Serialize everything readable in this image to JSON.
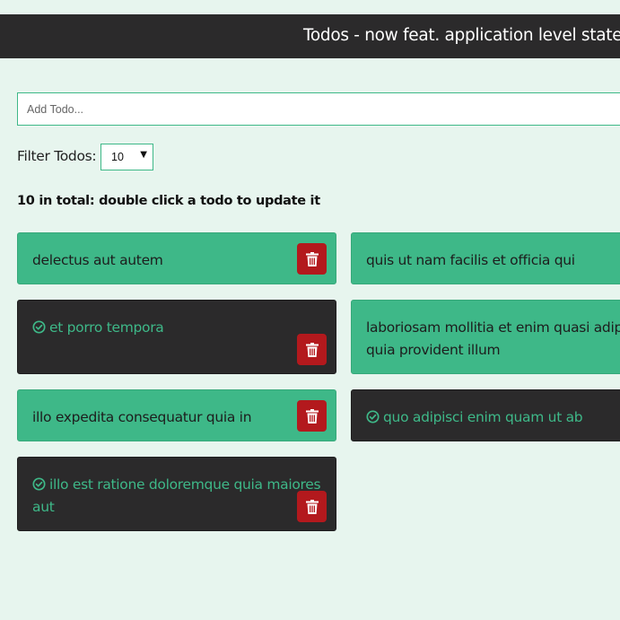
{
  "header": {
    "title": "Todos - now feat. application level state m"
  },
  "add_todo": {
    "placeholder": "Add Todo..."
  },
  "filter": {
    "label": "Filter Todos:",
    "selected": "10"
  },
  "summary": "10 in total: double click a todo to update it",
  "colors": {
    "accent": "#3eb888",
    "dark": "#2b2a2b",
    "danger": "#b3191d",
    "background": "#e7f5ee"
  },
  "todos": [
    {
      "text": "delectus aut autem",
      "completed": false,
      "delete_icon": "trash-icon"
    },
    {
      "text": "quis ut nam facilis et officia qui",
      "completed": false
    },
    {
      "text": "et porro tempora",
      "completed": true,
      "status_icon": "check-circle-icon",
      "delete_icon": "trash-icon"
    },
    {
      "text_lines": [
        "laboriosam mollitia et enim quasi adipi",
        "quia provident illum"
      ],
      "completed": false
    },
    {
      "text": "illo expedita consequatur quia in",
      "completed": false,
      "delete_icon": "trash-icon"
    },
    {
      "text": "quo adipisci enim quam ut ab",
      "completed": true,
      "status_icon": "check-circle-icon"
    },
    {
      "text_lines": [
        "illo est ratione doloremque quia maiores",
        "aut"
      ],
      "completed": true,
      "status_icon": "check-circle-icon",
      "delete_icon": "trash-icon"
    }
  ]
}
